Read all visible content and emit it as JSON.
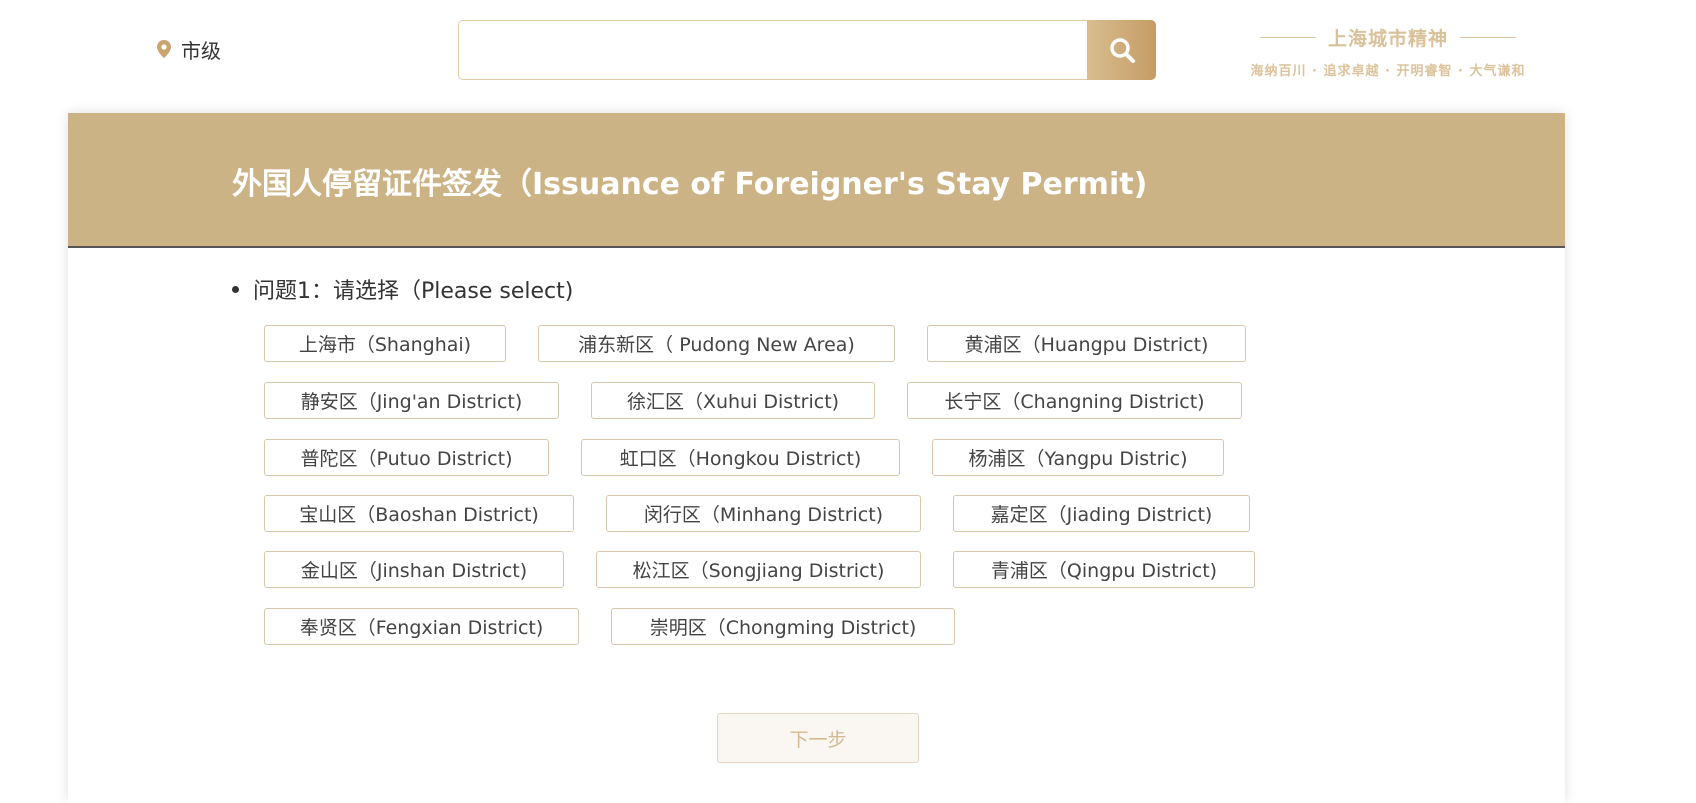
{
  "header": {
    "location_label": "市级",
    "search": {
      "placeholder": "",
      "value": ""
    },
    "slogan": {
      "title": "上海城市精神",
      "subtitle": "海纳百川 · 追求卓越 · 开明睿智 · 大气谦和"
    }
  },
  "page": {
    "title": "外国人停留证件签发（Issuance of Foreigner's Stay Permit)",
    "question": {
      "label": "问题1：请选择（Please select)",
      "options": [
        "上海市（Shanghai)",
        "浦东新区（ Pudong New Area)",
        "黄浦区（Huangpu District)",
        "静安区（Jing'an District)",
        "徐汇区（Xuhui District)",
        "长宁区（Changning District)",
        "普陀区（Putuo District)",
        "虹口区（Hongkou District)",
        "杨浦区（Yangpu Distric)",
        "宝山区（Baoshan District)",
        "闵行区（Minhang District)",
        "嘉定区（Jiading District)",
        "金山区（Jinshan District)",
        "松江区（Songjiang District)",
        "青浦区（Qingpu District)",
        "奉贤区（Fengxian District)",
        "崇明区（Chongming District)"
      ]
    },
    "next_label": "下一步"
  },
  "colors": {
    "brand_gold": "#ccb386",
    "button_gold": "#c69c65",
    "option_border": "#d6c7ac",
    "disabled_text": "#d4b990"
  }
}
